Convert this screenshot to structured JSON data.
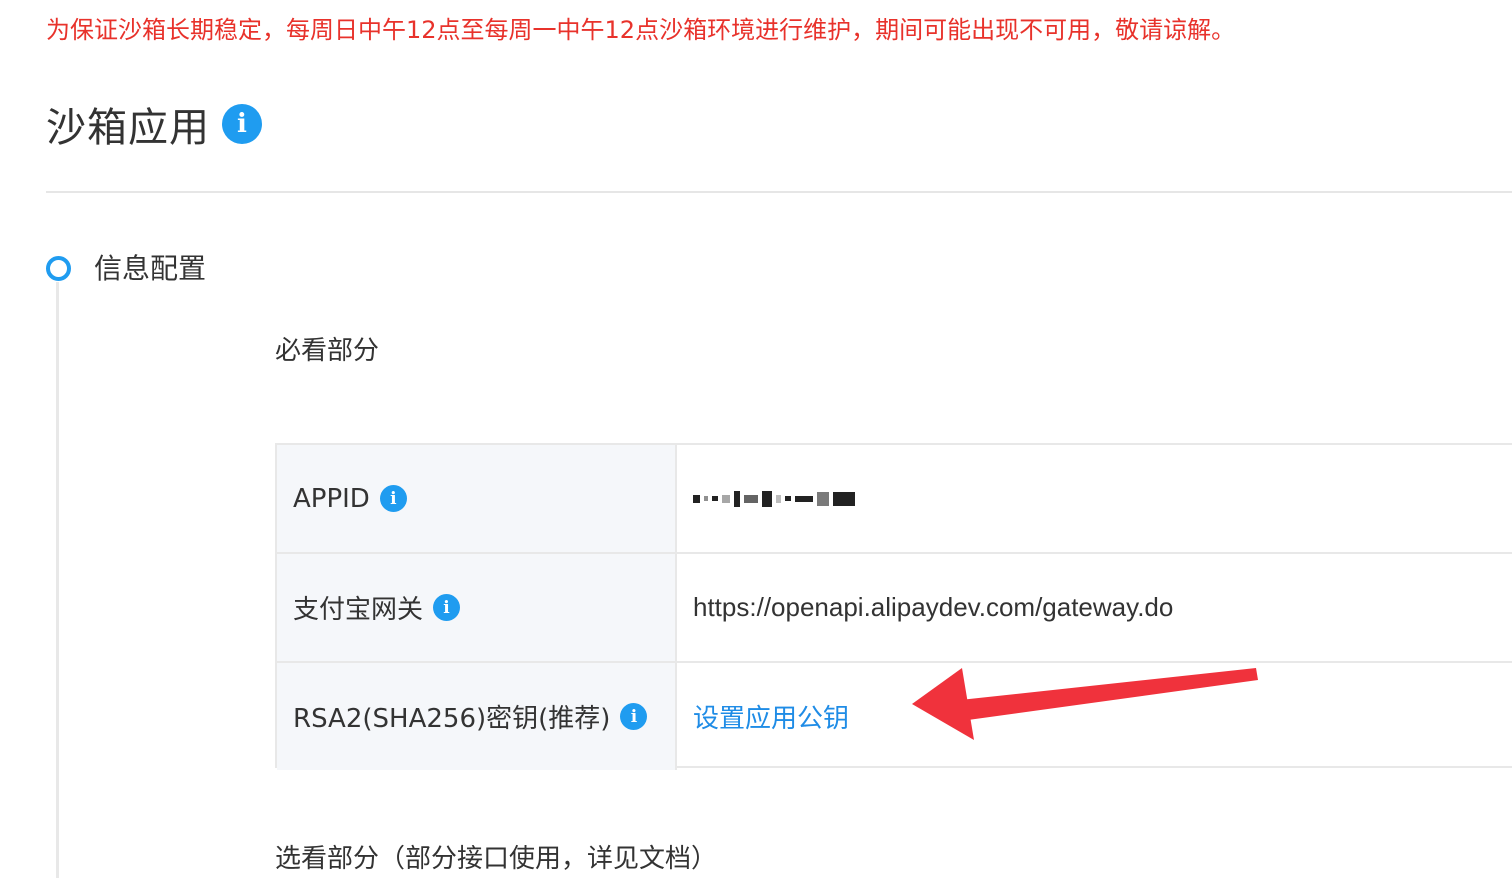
{
  "notice": "为保证沙箱长期稳定，每周日中午12点至每周一中午12点沙箱环境进行维护，期间可能出现不可用，敬请谅解。",
  "page": {
    "title": "沙箱应用",
    "info_glyph": "i"
  },
  "timeline": {
    "step_label": "信息配置"
  },
  "sections": {
    "required": "必看部分",
    "optional": "选看部分（部分接口使用，详见文档）"
  },
  "config_table": {
    "rows": [
      {
        "label": "APPID",
        "value": "",
        "value_masked": true
      },
      {
        "label": "支付宝网关",
        "value": "https://openapi.alipaydev.com/gateway.do"
      },
      {
        "label": "RSA2(SHA256)密钥(推荐)",
        "link": "设置应用公钥"
      }
    ]
  },
  "icons": {
    "info": "info-icon",
    "annotation": "red-arrow-icon"
  },
  "colors": {
    "notice_red": "#e8322b",
    "accent_blue": "#1f9cf0",
    "link_blue": "#1f8ce6",
    "arrow_red": "#f0323c"
  }
}
